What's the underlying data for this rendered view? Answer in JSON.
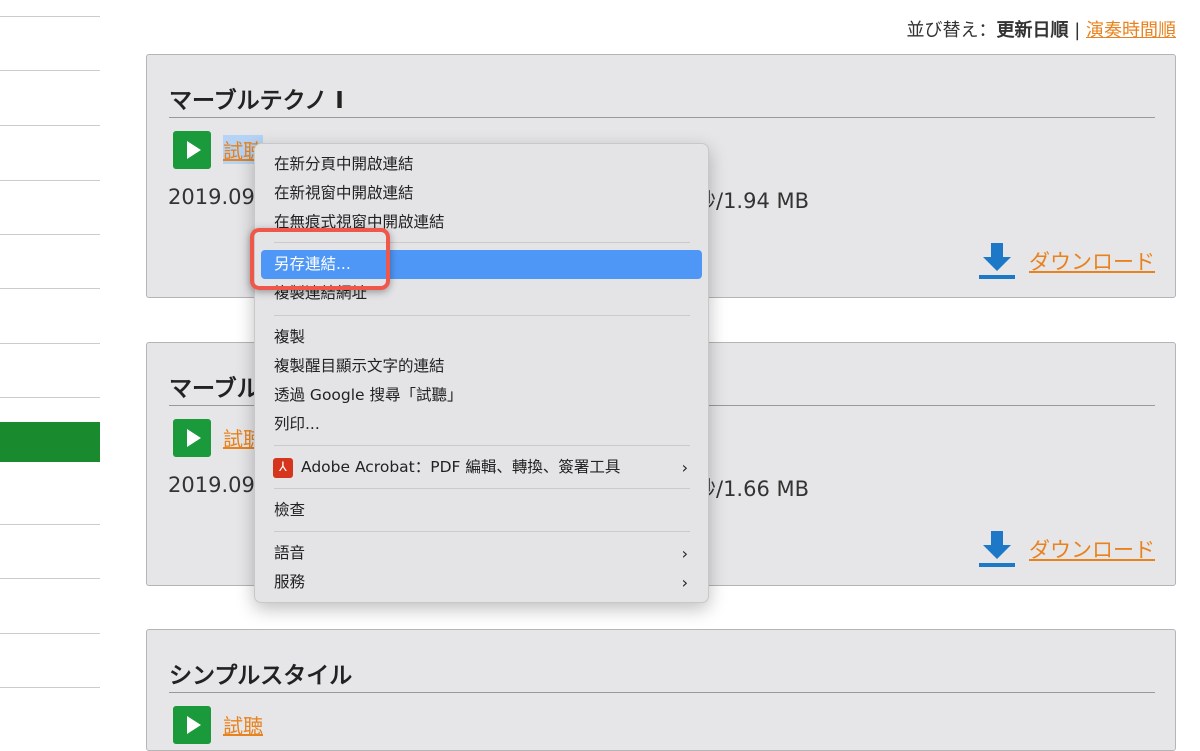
{
  "sort": {
    "label": "並び替え：",
    "current": "更新日順",
    "separator": "|",
    "alt": "演奏時間順"
  },
  "cards": [
    {
      "title": "マーブルテクノ I",
      "listen": "試聴",
      "meta_left": "2019.09",
      "meta_right": "秒/1.94 MB",
      "download": "ダウンロード"
    },
    {
      "title": "マーブル",
      "listen": "試聴",
      "meta_left": "2019.09",
      "meta_right": "秒/1.66 MB",
      "download": "ダウンロード"
    },
    {
      "title": "シンプルスタイル",
      "listen": "試聴"
    }
  ],
  "context_menu": {
    "items": [
      "在新分頁中開啟連結",
      "在新視窗中開啟連結",
      "在無痕式視窗中開啟連結",
      "另存連結...",
      "複製連結網址",
      "複製",
      "複製醒目顯示文字的連結",
      "透過 Google 搜尋「試聽」",
      "列印...",
      "Adobe Acrobat：PDF 編輯、轉換、簽署工具",
      "檢查",
      "語音",
      "服務"
    ],
    "submenu_arrow": "›"
  },
  "colors": {
    "accent": "#e8821e",
    "highlight": "#4f97f7",
    "callout": "#f0574b",
    "play": "#1a9a3a"
  }
}
